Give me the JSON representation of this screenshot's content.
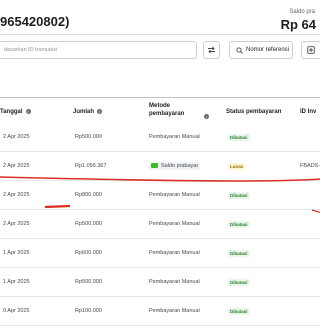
{
  "header": {
    "account_title": "965420802)",
    "balance_label": "Saldo pra",
    "balance_value": "Rp 64"
  },
  "toolbar": {
    "search_placeholder": "dasarkan ID transaksi",
    "reference_button_label": "Nomor referensi"
  },
  "table": {
    "headers": {
      "date": "Tanggal",
      "amount": "Jumlah",
      "method_line1": "Metode",
      "method_line2": "pembayaran",
      "status": "Status pembayaran",
      "id": "ID Inv"
    },
    "rows": [
      {
        "date": "2 Apr 2025",
        "amount": "Rp500.000",
        "method": "Pembayaran Manual",
        "status": "Dibatasi",
        "status_color": "#e9f6ea",
        "id": ""
      },
      {
        "date": "2 Apr 2025",
        "amount": "Rp1.056.367",
        "method": "Saldo prabayar",
        "status": "Lunas",
        "status_color": "#fff4d6",
        "id": "FBADS-"
      },
      {
        "date": "2 Apr 2025",
        "amount": "Rp800.000",
        "method": "Pembayaran Manual",
        "status": "Dibatasi",
        "status_color": "#e9f6ea",
        "id": ""
      },
      {
        "date": "2 Apr 2025",
        "amount": "Rp500.000",
        "method": "Pembayaran Manual",
        "status": "Dibatasi",
        "status_color": "#e9f6ea",
        "id": ""
      },
      {
        "date": "1 Apr 2025",
        "amount": "Rp600.000",
        "method": "Pembayaran Manual",
        "status": "Dibatasi",
        "status_color": "#e9f6ea",
        "id": ""
      },
      {
        "date": "1 Apr 2025",
        "amount": "Rp500.000",
        "method": "Pembayaran Manual",
        "status": "Dibatasi",
        "status_color": "#e9f6ea",
        "id": ""
      },
      {
        "date": "0 Apr 2025",
        "amount": "Rp100.000",
        "method": "Pembayaran Manual",
        "status": "Dibatasi",
        "status_color": "#e9f6ea",
        "id": ""
      }
    ]
  },
  "annotation_color": "#d93025",
  "icons": [
    "search-icon",
    "sort-icon",
    "search-icon",
    "export-icon",
    "info-icon",
    "wallet-icon"
  ]
}
